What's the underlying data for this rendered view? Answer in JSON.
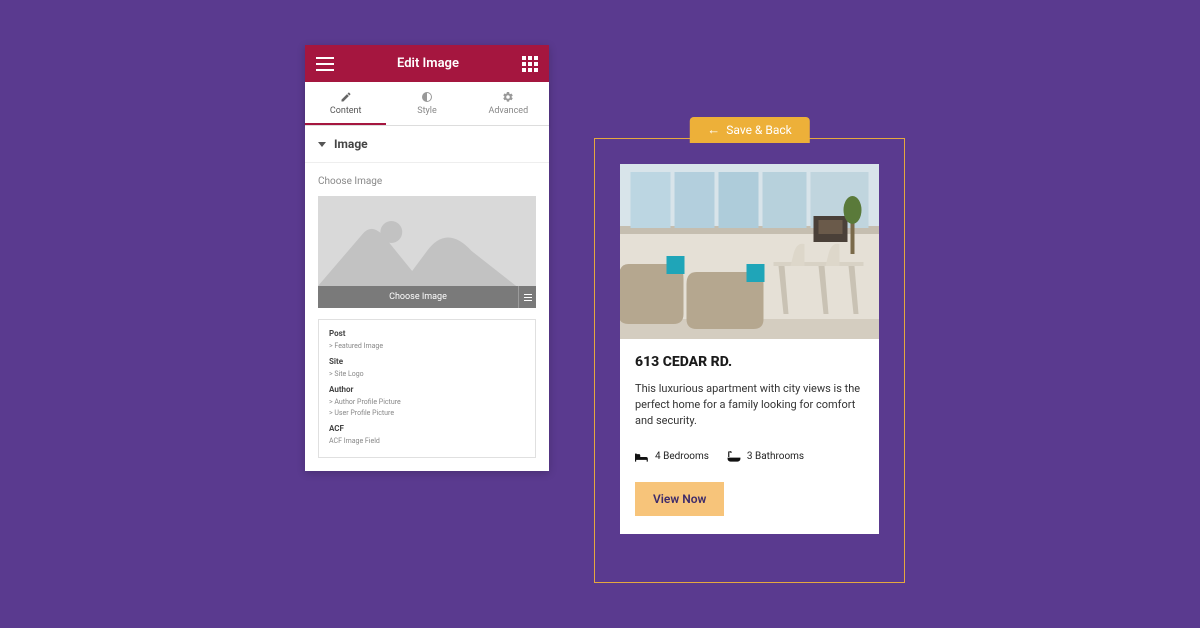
{
  "editor": {
    "header_title": "Edit Image",
    "tabs": [
      {
        "label": "Content"
      },
      {
        "label": "Style"
      },
      {
        "label": "Advanced"
      }
    ],
    "accordion_title": "Image",
    "choose_image_label": "Choose Image",
    "choose_image_button": "Choose Image",
    "sources": {
      "post": {
        "title": "Post",
        "items": [
          "> Featured Image"
        ]
      },
      "site": {
        "title": "Site",
        "items": [
          "> Site Logo"
        ]
      },
      "author": {
        "title": "Author",
        "items": [
          "> Author Profile Picture",
          "> User Profile Picture"
        ]
      },
      "acf": {
        "title": "ACF",
        "items": [
          "ACF Image Field"
        ]
      }
    }
  },
  "preview": {
    "save_back": "Save & Back",
    "title": "613 CEDAR RD.",
    "description": "This luxurious apartment with city views is the perfect home for a family looking for comfort and security.",
    "bedrooms": "4 Bedrooms",
    "bathrooms": "3 Bathrooms",
    "view_button": "View Now"
  }
}
